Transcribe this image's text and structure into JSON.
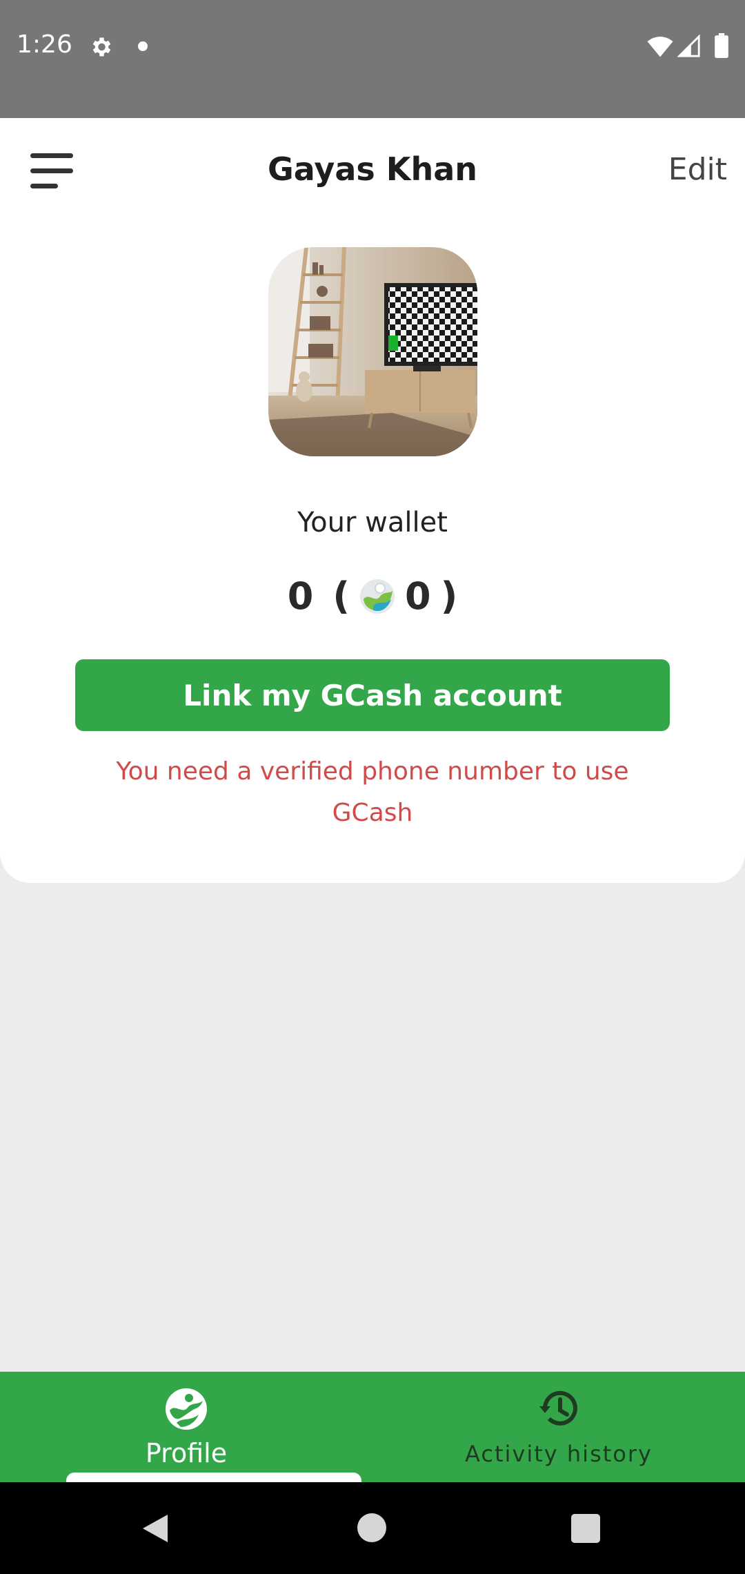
{
  "status_bar": {
    "time": "1:26",
    "icons": [
      "settings-gear-icon",
      "notification-dot-icon",
      "wifi-icon",
      "signal-icon",
      "battery-icon"
    ]
  },
  "header": {
    "menu_icon": "hamburger-menu-icon",
    "title": "Gayas Khan",
    "edit_label": "Edit"
  },
  "profile": {
    "avatar": "room-with-tv-photo"
  },
  "wallet": {
    "label": "Your wallet",
    "balance": "0",
    "paren_open": "(",
    "coin_icon": "gcash-coin-icon",
    "coin_balance": "0",
    "paren_close": ")"
  },
  "gcash": {
    "button_label": "Link my GCash account",
    "warning": "You need a verified phone number to use GCash"
  },
  "bottom_nav": {
    "items": [
      {
        "label": "Profile",
        "icon": "profile-globe-icon",
        "active": true
      },
      {
        "label": "Activity history",
        "icon": "history-clock-icon",
        "active": false
      }
    ]
  },
  "colors": {
    "primary_green": "#34a64a",
    "status_bar": "#777777",
    "warning_red": "#d04a4a",
    "background": "#ececec"
  }
}
